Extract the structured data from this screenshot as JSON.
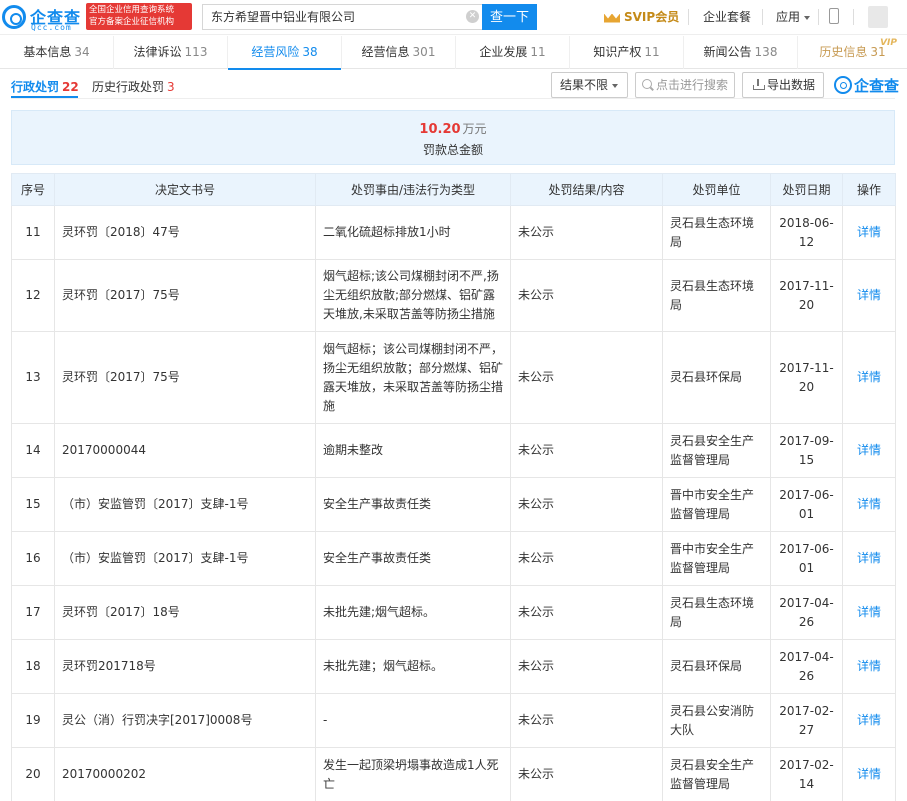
{
  "header": {
    "logo": "企查查",
    "logo_domain": "Qcc.com",
    "badge_line1": "全国企业信用查询系统",
    "badge_line2": "官方备案企业征信机构",
    "search_value": "东方希望晋中铝业有限公司",
    "search_button": "查一下",
    "svip": "SVIP会员",
    "enterprise_package": "企业套餐",
    "apps": "应用"
  },
  "tabs": [
    {
      "label": "基本信息",
      "count": "34"
    },
    {
      "label": "法律诉讼",
      "count": "113"
    },
    {
      "label": "经营风险",
      "count": "38"
    },
    {
      "label": "经营信息",
      "count": "301"
    },
    {
      "label": "企业发展",
      "count": "11"
    },
    {
      "label": "知识产权",
      "count": "11"
    },
    {
      "label": "新闻公告",
      "count": "138"
    },
    {
      "label": "历史信息",
      "count": "31",
      "badge": "VIP"
    }
  ],
  "subtabs": [
    {
      "label": "行政处罚",
      "count": "22"
    },
    {
      "label": "历史行政处罚",
      "count": "3"
    }
  ],
  "toolbar": {
    "result_filter": "结果不限",
    "search_placeholder": "点击进行搜索",
    "export": "导出数据",
    "brand": "企查查"
  },
  "summary": {
    "amount": "10.20",
    "unit": "万元",
    "label": "罚款总金额"
  },
  "table": {
    "headers": [
      "序号",
      "决定文书号",
      "处罚事由/违法行为类型",
      "处罚结果/内容",
      "处罚单位",
      "处罚日期",
      "操作"
    ],
    "rows": [
      {
        "no": "11",
        "doc": "灵环罚〔2018〕47号",
        "reason": "二氧化硫超标排放1小时",
        "result": "未公示",
        "unit": "灵石县生态环境局",
        "date": "2018-06-12",
        "action": "详情"
      },
      {
        "no": "12",
        "doc": "灵环罚〔2017〕75号",
        "reason": "烟气超标;该公司煤棚封闭不严,扬尘无组织放散;部分燃煤、铝矿露天堆放,未采取苫盖等防扬尘措施",
        "result": "未公示",
        "unit": "灵石县生态环境局",
        "date": "2017-11-20",
        "action": "详情"
      },
      {
        "no": "13",
        "doc": "灵环罚〔2017〕75号",
        "reason": "烟气超标；该公司煤棚封闭不严，扬尘无组织放散；部分燃煤、铝矿露天堆放，未采取苫盖等防扬尘措施",
        "result": "未公示",
        "unit": "灵石县环保局",
        "date": "2017-11-20",
        "action": "详情"
      },
      {
        "no": "14",
        "doc": "20170000044",
        "reason": "逾期未整改",
        "result": "未公示",
        "unit": "灵石县安全生产监督管理局",
        "date": "2017-09-15",
        "action": "详情"
      },
      {
        "no": "15",
        "doc": "（市）安监管罚〔2017〕支肆-1号",
        "reason": "安全生产事故责任类",
        "result": "未公示",
        "unit": "晋中市安全生产监督管理局",
        "date": "2017-06-01",
        "action": "详情"
      },
      {
        "no": "16",
        "doc": "（市）安监管罚〔2017〕支肆-1号",
        "reason": "安全生产事故责任类",
        "result": "未公示",
        "unit": "晋中市安全生产监督管理局",
        "date": "2017-06-01",
        "action": "详情"
      },
      {
        "no": "17",
        "doc": "灵环罚〔2017〕18号",
        "reason": "未批先建;烟气超标。",
        "result": "未公示",
        "unit": "灵石县生态环境局",
        "date": "2017-04-26",
        "action": "详情"
      },
      {
        "no": "18",
        "doc": "灵环罚201718号",
        "reason": "未批先建；烟气超标。",
        "result": "未公示",
        "unit": "灵石县环保局",
        "date": "2017-04-26",
        "action": "详情"
      },
      {
        "no": "19",
        "doc": "灵公（消）行罚决字[2017]0008号",
        "reason": "-",
        "result": "未公示",
        "unit": "灵石县公安消防大队",
        "date": "2017-02-27",
        "action": "详情"
      },
      {
        "no": "20",
        "doc": "20170000202",
        "reason": "发生一起顶梁坍塌事故造成1人死亡",
        "result": "未公示",
        "unit": "灵石县安全生产监督管理局",
        "date": "2017-02-14",
        "action": "详情"
      }
    ]
  }
}
